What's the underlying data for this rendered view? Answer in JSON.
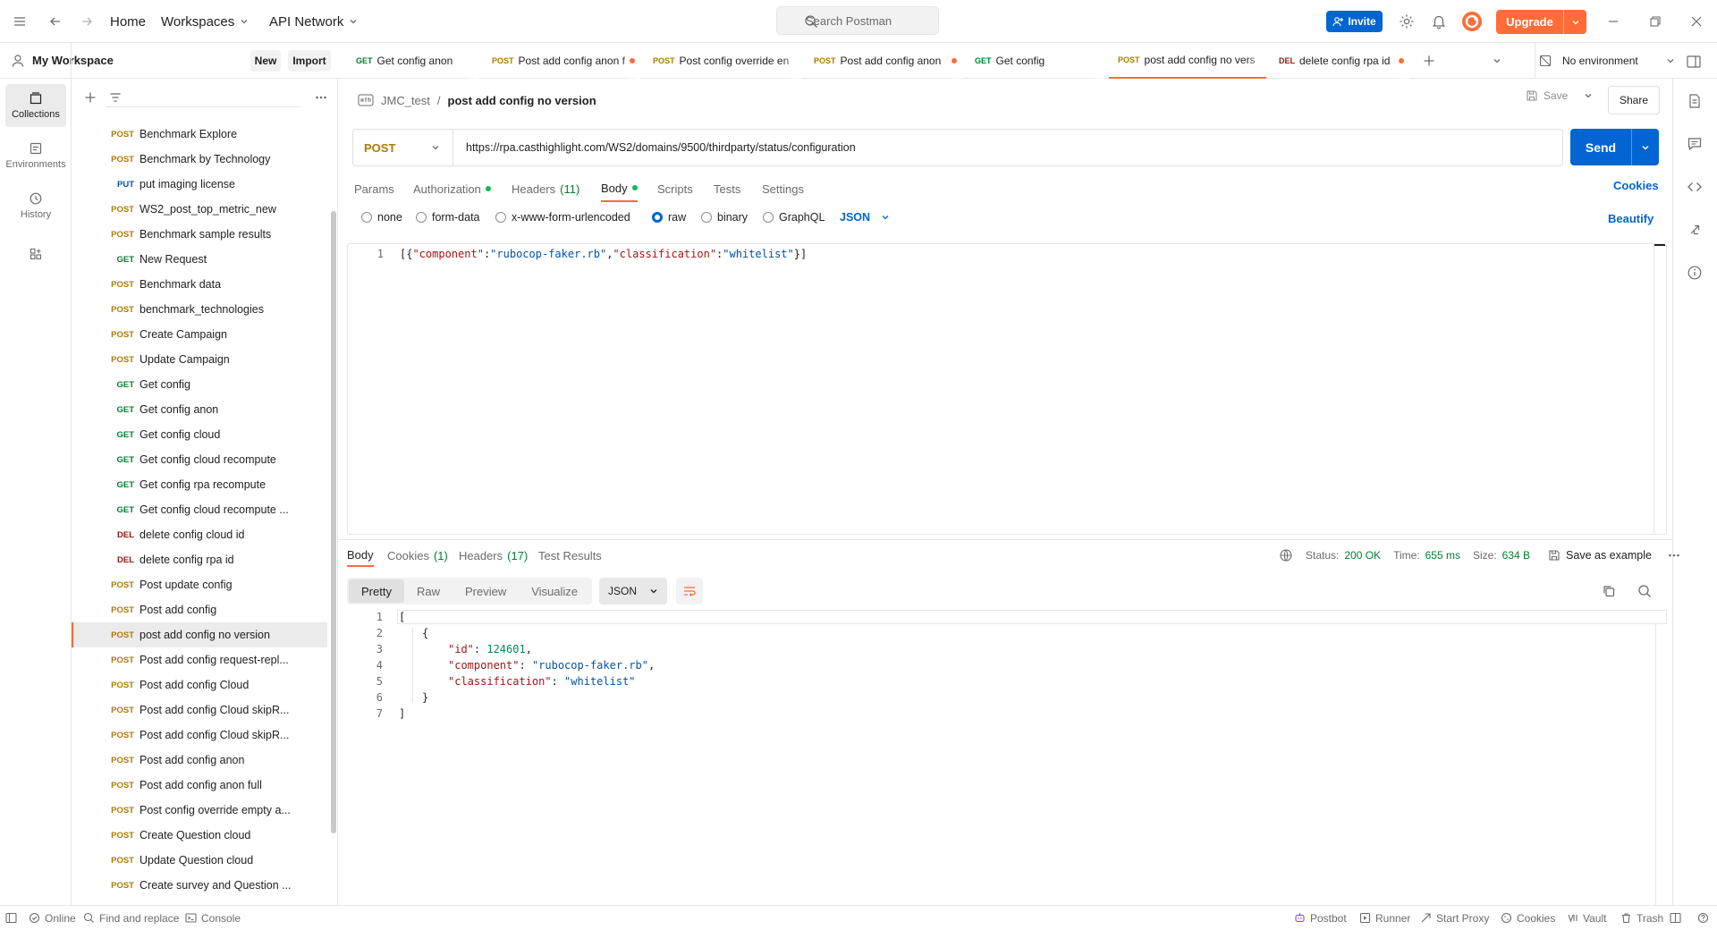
{
  "topbar": {
    "home": "Home",
    "workspaces": "Workspaces",
    "api_network": "API Network",
    "search_placeholder": "Search Postman",
    "invite": "Invite",
    "upgrade": "Upgrade"
  },
  "workspace": {
    "name": "My Workspace",
    "new_label": "New",
    "import_label": "Import"
  },
  "rail": {
    "collections": "Collections",
    "environments": "Environments",
    "history": "History"
  },
  "sidebar": {
    "items": [
      {
        "method": "POST",
        "name": "Benchmark Explore"
      },
      {
        "method": "POST",
        "name": "Benchmark by Technology"
      },
      {
        "method": "PUT",
        "name": "put imaging license"
      },
      {
        "method": "POST",
        "name": "WS2_post_top_metric_new"
      },
      {
        "method": "POST",
        "name": "Benchmark sample results"
      },
      {
        "method": "GET",
        "name": "New Request"
      },
      {
        "method": "POST",
        "name": "Benchmark data"
      },
      {
        "method": "POST",
        "name": "benchmark_technologies"
      },
      {
        "method": "POST",
        "name": "Create Campaign"
      },
      {
        "method": "POST",
        "name": "Update Campaign"
      },
      {
        "method": "GET",
        "name": "Get config"
      },
      {
        "method": "GET",
        "name": "Get config anon"
      },
      {
        "method": "GET",
        "name": "Get config cloud"
      },
      {
        "method": "GET",
        "name": "Get config cloud recompute"
      },
      {
        "method": "GET",
        "name": "Get config rpa recompute"
      },
      {
        "method": "GET",
        "name": "Get config cloud recompute ..."
      },
      {
        "method": "DEL",
        "name": "delete config cloud id"
      },
      {
        "method": "DEL",
        "name": "delete config rpa id"
      },
      {
        "method": "POST",
        "name": "Post update config"
      },
      {
        "method": "POST",
        "name": "Post add config"
      },
      {
        "method": "POST",
        "name": "post add config no version"
      },
      {
        "method": "POST",
        "name": "Post add config request-repl..."
      },
      {
        "method": "POST",
        "name": "Post add config Cloud"
      },
      {
        "method": "POST",
        "name": "Post add config Cloud skipR..."
      },
      {
        "method": "POST",
        "name": "Post add config Cloud skipR..."
      },
      {
        "method": "POST",
        "name": "Post add config anon"
      },
      {
        "method": "POST",
        "name": "Post add config anon full"
      },
      {
        "method": "POST",
        "name": "Post config override empty a..."
      },
      {
        "method": "POST",
        "name": "Create Question cloud"
      },
      {
        "method": "POST",
        "name": "Update Question cloud"
      },
      {
        "method": "POST",
        "name": "Create survey and Question ..."
      }
    ]
  },
  "tabs": [
    {
      "method": "GET",
      "name": "Get config anon"
    },
    {
      "method": "POST",
      "name": "Post add config anon f"
    },
    {
      "method": "POST",
      "name": "Post config override en"
    },
    {
      "method": "POST",
      "name": "Post add config anon"
    },
    {
      "method": "GET",
      "name": "Get config"
    },
    {
      "method": "POST",
      "name": "post add config no vers"
    },
    {
      "method": "DEL",
      "name": "delete config rpa id"
    }
  ],
  "environment": "No environment",
  "request": {
    "collection": "JMC_test",
    "separator": "/",
    "name": "post add config no version",
    "save": "Save",
    "share": "Share",
    "method": "POST",
    "url": "https://rpa.casthighlight.com/WS2/domains/9500/thirdparty/status/configuration",
    "send": "Send",
    "tabs": {
      "params": "Params",
      "authorization": "Authorization",
      "headers": "Headers",
      "headers_count": "(11)",
      "body": "Body",
      "scripts": "Scripts",
      "tests": "Tests",
      "settings": "Settings",
      "cookies": "Cookies"
    },
    "body_types": {
      "none": "none",
      "form_data": "form-data",
      "urlencoded": "x-www-form-urlencoded",
      "raw": "raw",
      "binary": "binary",
      "graphql": "GraphQL",
      "format": "JSON",
      "beautify": "Beautify"
    },
    "body_line_no": "1",
    "body_parts": {
      "open": "[{",
      "k1": "\"component\"",
      "c1": ":",
      "v1": "\"rubocop-faker.rb\"",
      "sep": ",",
      "k2": "\"classification\"",
      "c2": ":",
      "v2": "\"whitelist\"",
      "close": "}]"
    }
  },
  "response": {
    "tabs": {
      "body": "Body",
      "cookies": "Cookies",
      "cookies_count": "(1)",
      "headers": "Headers",
      "headers_count": "(17)",
      "test_results": "Test Results"
    },
    "status_label": "Status:",
    "status_value": "200 OK",
    "time_label": "Time:",
    "time_value": "655 ms",
    "size_label": "Size:",
    "size_value": "634 B",
    "save_example": "Save as example",
    "views": {
      "pretty": "Pretty",
      "raw": "Raw",
      "preview": "Preview",
      "visualize": "Visualize"
    },
    "format": "JSON",
    "line_numbers": [
      "1",
      "2",
      "3",
      "4",
      "5",
      "6",
      "7"
    ],
    "json": {
      "l1": "[",
      "l2": "{",
      "k_id": "\"id\"",
      "v_id": "124601",
      "k_comp": "\"component\"",
      "v_comp": "\"rubocop-faker.rb\"",
      "k_class": "\"classification\"",
      "v_class": "\"whitelist\"",
      "l6": "}",
      "l7": "]"
    }
  },
  "statusbar": {
    "online": "Online",
    "find_replace": "Find and replace",
    "console": "Console",
    "postbot": "Postbot",
    "runner": "Runner",
    "start_proxy": "Start Proxy",
    "cookies": "Cookies",
    "vault": "Vault",
    "trash": "Trash"
  },
  "colors": {
    "brand": "#ff6c37",
    "primary": "#0265d2",
    "post": "#ad7a03",
    "get": "#007f31",
    "put": "#0053b8",
    "del": "#8e1a10"
  }
}
